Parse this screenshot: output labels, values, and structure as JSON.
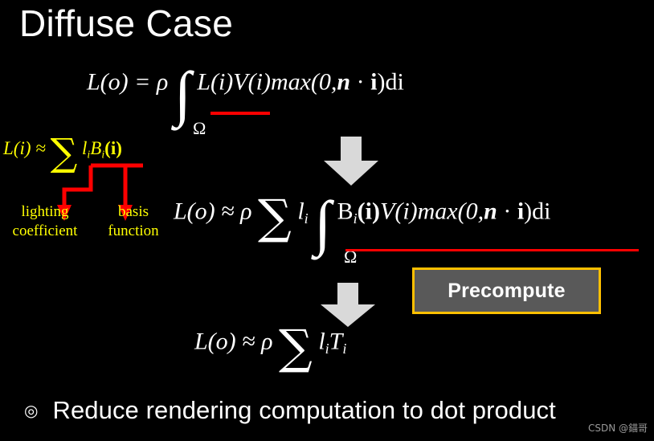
{
  "slide": {
    "title": "Diffuse Case",
    "background_color": "#000000",
    "text_color": "#ffffff"
  },
  "equations": {
    "eq1": {
      "lhs": "L(o) =",
      "rho": "ρ",
      "integral": "∫",
      "domain": "Ω",
      "integrand_underlined": "L(i)",
      "integrand_rest": "V(i)max(0,",
      "normal": "n",
      "dot": " · ",
      "incident": "i",
      "close": ")di",
      "full_text": "L(o) = ρ ∫Ω L(i)V(i)max(0,n · i)di"
    },
    "eq_sh": {
      "lhs": "L(i) ≈",
      "sigma": "∑",
      "coeff": "l",
      "coeff_sub": "i",
      "basis": "B",
      "basis_sub": "i",
      "basis_arg": "(i)",
      "color": "#ffff00",
      "full_text": "L(i) ≈ ∑ lᵢBᵢ(i)"
    },
    "eq2": {
      "lhs": "L(o) ≈",
      "rho": "ρ",
      "sigma": "∑",
      "coeff": "l",
      "coeff_sub": "i",
      "integral": "∫",
      "domain": "Ω",
      "basis": "B",
      "basis_sub": "i",
      "basis_arg": "(i)",
      "rest": "V(i)max(0,",
      "normal": "n",
      "dot": " · ",
      "incident": "i",
      "close": ")di",
      "full_text": "L(o) ≈ ρ ∑ lᵢ ∫Ω Bᵢ(i)V(i)max(0,n · i)di"
    },
    "eq3": {
      "lhs": "L(o) ≈",
      "rho": "ρ",
      "sigma": "∑",
      "coeff": "l",
      "coeff_sub": "i",
      "transfer": "T",
      "transfer_sub": "i",
      "full_text": "L(o) ≈ ρ ∑ lᵢTᵢ"
    }
  },
  "annotations": {
    "lighting_label_line1": "lighting",
    "lighting_label_line2": "coefficient",
    "basis_label_line1": "basis",
    "basis_label_line2": "function",
    "arrow_color": "#ff0000",
    "label_color": "#ffff00",
    "underline_color": "#ff0000"
  },
  "precompute": {
    "label": "Precompute",
    "fill_color": "#595959",
    "border_color": "#ffc000",
    "text_color": "#ffffff"
  },
  "flow_arrows": {
    "fill_color": "#d9d9d9",
    "count": 2
  },
  "bullet": {
    "marker": "◎",
    "text": "Reduce rendering computation to dot product"
  },
  "watermark": {
    "text": "CSDN @錨哥"
  }
}
